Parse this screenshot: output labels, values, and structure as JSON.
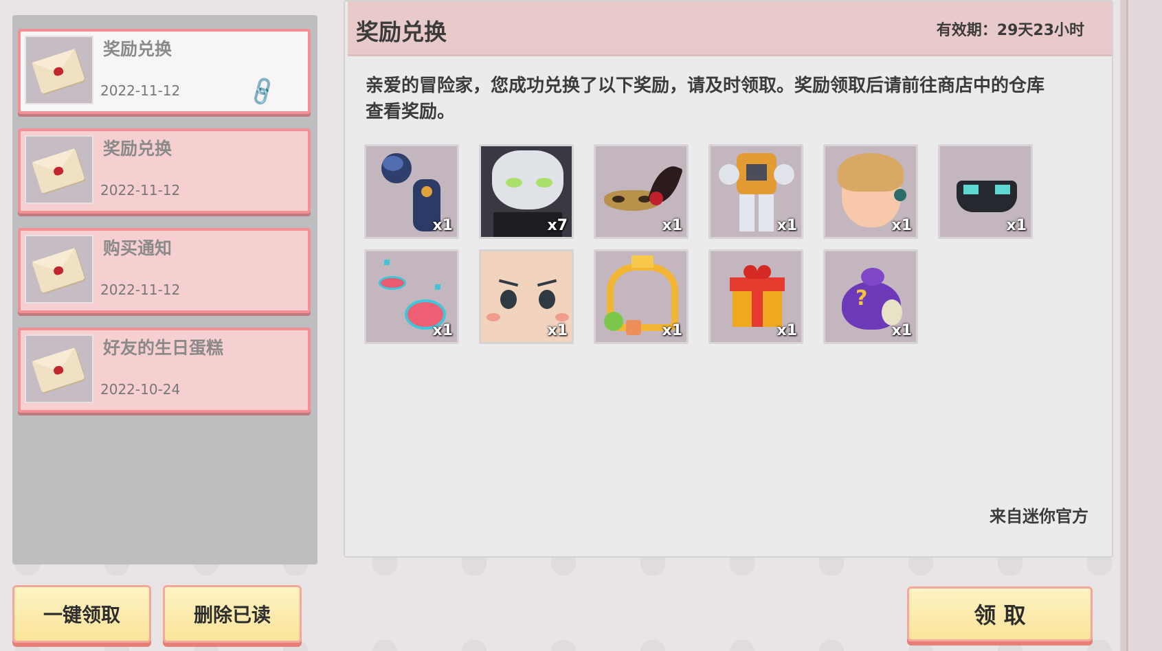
{
  "mail_list": [
    {
      "title": "奖励兑换",
      "date": "2022-11-12",
      "has_attachment": true,
      "selected": true
    },
    {
      "title": "奖励兑换",
      "date": "2022-11-12",
      "has_attachment": false,
      "selected": false
    },
    {
      "title": "购买通知",
      "date": "2022-11-12",
      "has_attachment": false,
      "selected": false
    },
    {
      "title": "好友的生日蛋糕",
      "date": "2022-10-24",
      "has_attachment": false,
      "selected": false
    }
  ],
  "buttons": {
    "claim_all": "一键领取",
    "delete_read": "删除已读",
    "claim": "领 取"
  },
  "mail_detail": {
    "title": "奖励兑换",
    "validity": "有效期：29天23小时",
    "message": "亲爱的冒险家，您成功兑换了以下奖励，请及时领取。奖励领取后请前往商店中的仓库查看奖励。",
    "sender": "来自迷你官方"
  },
  "rewards": [
    {
      "icon": "armor-gauntlet-icon",
      "qty": "x1"
    },
    {
      "icon": "wolf-character-icon",
      "qty": "x7"
    },
    {
      "icon": "masquerade-mask-icon",
      "qty": "x1"
    },
    {
      "icon": "mech-suit-icon",
      "qty": "x1"
    },
    {
      "icon": "hairstyle-icon",
      "qty": "x1"
    },
    {
      "icon": "cyber-glasses-icon",
      "qty": "x1"
    },
    {
      "icon": "portal-effect-icon",
      "qty": "x1"
    },
    {
      "icon": "face-expression-icon",
      "qty": "x1"
    },
    {
      "icon": "avatar-frame-icon",
      "qty": "x1"
    },
    {
      "icon": "gift-box-icon",
      "qty": "x1"
    },
    {
      "icon": "mystery-bag-icon",
      "qty": "x1"
    }
  ],
  "colors": {
    "accent_pink": "#f38f95",
    "button_yellow": "#fbe49a",
    "header_pink": "#e9caca"
  }
}
